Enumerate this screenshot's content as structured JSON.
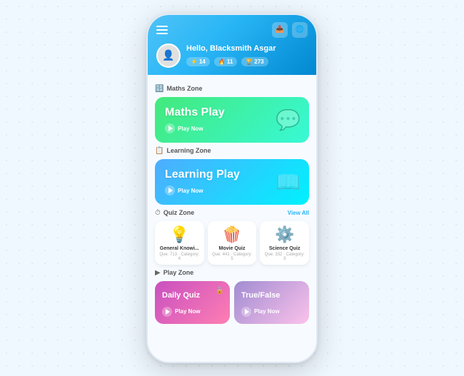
{
  "header": {
    "greeting": "Hello, Blacksmith Asgar",
    "stats": [
      {
        "icon": "⚡",
        "value": "14"
      },
      {
        "icon": "🔥",
        "value": "11"
      },
      {
        "icon": "🏆",
        "value": "273"
      }
    ],
    "icons_right": [
      "📥",
      "🌐"
    ]
  },
  "sections": {
    "maths_zone": {
      "label": "Maths Zone",
      "card": {
        "title": "Maths Play",
        "play_label": "Play Now",
        "deco": "💬"
      }
    },
    "learning_zone": {
      "label": "Learning Zone",
      "card": {
        "title": "Learning Play",
        "play_label": "Play Now",
        "deco": "📖"
      }
    },
    "quiz_zone": {
      "label": "Quiz Zone",
      "view_all": "View All",
      "items": [
        {
          "emoji": "💡",
          "name": "General Knowi...",
          "meta": "Que: 713 · Category: 4"
        },
        {
          "emoji": "🍿",
          "name": "Movie Quiz",
          "meta": "Que: 441 · Category: 5"
        },
        {
          "emoji": "⚙️",
          "name": "Science Quiz",
          "meta": "Que: 332 · Category: 3"
        }
      ]
    },
    "play_zone": {
      "label": "Play Zone",
      "cards": [
        {
          "title": "Daily Quiz",
          "play_label": "Play Now",
          "style": "daily",
          "locked": true
        },
        {
          "title": "True/False",
          "play_label": "Play Now",
          "style": "trueFalse",
          "locked": false
        }
      ]
    }
  }
}
